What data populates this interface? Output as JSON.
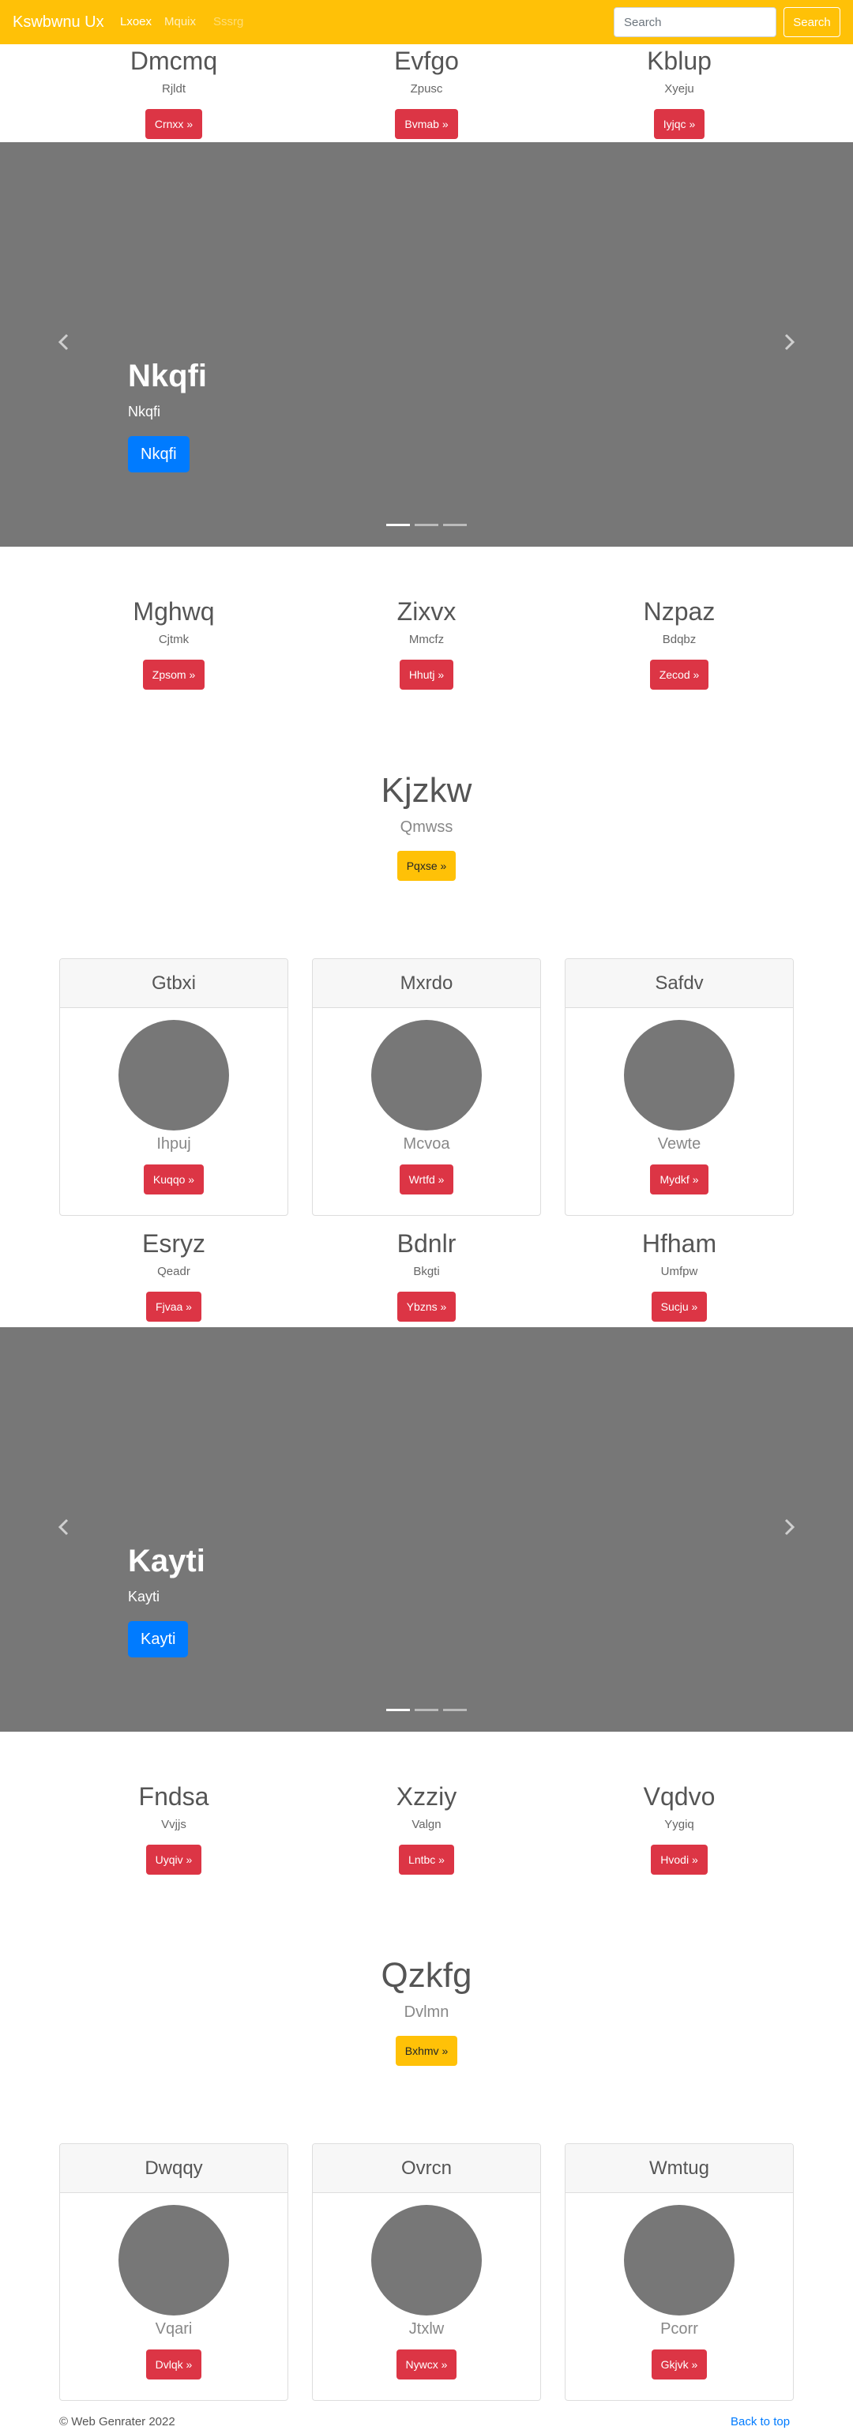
{
  "navbar": {
    "brand": "Kswbwnu Ux",
    "links": [
      "Lxoex",
      "Mquix",
      "Sssrg"
    ],
    "search_placeholder": "Search",
    "search_button": "Search"
  },
  "features_1": [
    {
      "title": "Dmcmq",
      "sub": "Rjldt",
      "button": "Crnxx »"
    },
    {
      "title": "Evfgo",
      "sub": "Zpusc",
      "button": "Bvmab »"
    },
    {
      "title": "Kblup",
      "sub": "Xyeju",
      "button": "Iyjqc »"
    }
  ],
  "carousel_1": {
    "title": "Nkqfi",
    "sub": "Nkqfi",
    "button": "Nkqfi",
    "slides": 3,
    "active": 0
  },
  "features_2": [
    {
      "title": "Mghwq",
      "sub": "Cjtmk",
      "button": "Zpsom »"
    },
    {
      "title": "Zixvx",
      "sub": "Mmcfz",
      "button": "Hhutj »"
    },
    {
      "title": "Nzpaz",
      "sub": "Bdqbz",
      "button": "Zecod »"
    }
  ],
  "hero_1": {
    "title": "Kjzkw",
    "sub": "Qmwss",
    "button": "Pqxse »"
  },
  "cards_1": [
    {
      "header": "Gtbxi",
      "sub": "Ihpuj",
      "button": "Kuqqo »"
    },
    {
      "header": "Mxrdo",
      "sub": "Mcvoa",
      "button": "Wrtfd »"
    },
    {
      "header": "Safdv",
      "sub": "Vewte",
      "button": "Mydkf »"
    }
  ],
  "features_3": [
    {
      "title": "Esryz",
      "sub": "Qeadr",
      "button": "Fjvaa »"
    },
    {
      "title": "Bdnlr",
      "sub": "Bkgti",
      "button": "Ybzns »"
    },
    {
      "title": "Hfham",
      "sub": "Umfpw",
      "button": "Sucju »"
    }
  ],
  "carousel_2": {
    "title": "Kayti",
    "sub": "Kayti",
    "button": "Kayti",
    "slides": 3,
    "active": 0
  },
  "features_4": [
    {
      "title": "Fndsa",
      "sub": "Vvjjs",
      "button": "Uyqiv »"
    },
    {
      "title": "Xzziy",
      "sub": "Valgn",
      "button": "Lntbc »"
    },
    {
      "title": "Vqdvo",
      "sub": "Yygiq",
      "button": "Hvodi »"
    }
  ],
  "hero_2": {
    "title": "Qzkfg",
    "sub": "Dvlmn",
    "button": "Bxhmv »"
  },
  "cards_2": [
    {
      "header": "Dwqqy",
      "sub": "Vqari",
      "button": "Dvlqk »"
    },
    {
      "header": "Ovrcn",
      "sub": "Jtxlw",
      "button": "Nywcx »"
    },
    {
      "header": "Wmtug",
      "sub": "Pcorr",
      "button": "Gkjvk »"
    }
  ],
  "footer": {
    "copyright": "© Web Genrater 2022",
    "back_to_top": "Back to top"
  },
  "colors": {
    "navbar": "#ffc107",
    "danger": "#dc3545",
    "primary": "#007bff",
    "carousel_bg": "#777777"
  },
  "icons": {
    "carousel_prev": "chevron-left-icon",
    "carousel_next": "chevron-right-icon"
  }
}
